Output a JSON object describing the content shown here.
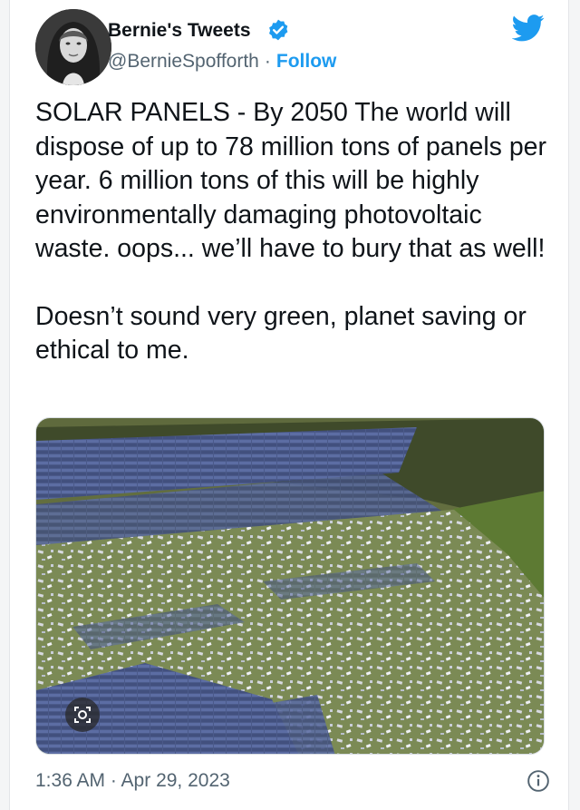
{
  "author": {
    "name": "Bernie's Tweets",
    "handle": "@BernieSpofforth",
    "separator": "·",
    "follow_label": "Follow",
    "verified_icon": "verified-badge-icon"
  },
  "tweet": {
    "paragraphs": [
      "SOLAR PANELS - By 2050 The world will dispose of up to 78 million tons of panels per year. 6 million tons of this will be highly environmentally damaging photovoltaic waste. oops... we’ll have to bury that as well!",
      "Doesn’t sound very green, planet saving or ethical to me."
    ]
  },
  "media": {
    "icon": "lens-search-icon"
  },
  "footer": {
    "timestamp": "1:36 AM · Apr 29, 2023",
    "info_icon": "info-icon"
  },
  "colors": {
    "accent": "#1d9bf0",
    "text": "#0f1419",
    "muted": "#536471"
  }
}
